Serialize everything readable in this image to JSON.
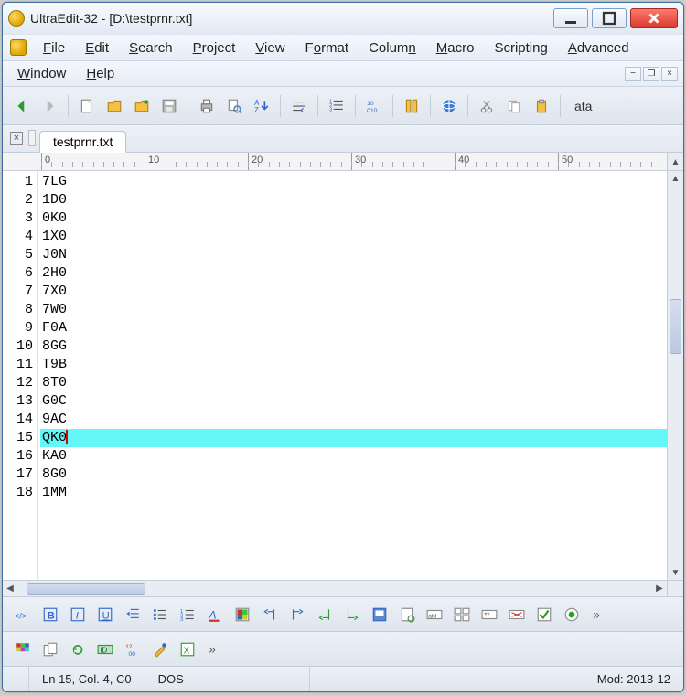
{
  "titlebar": {
    "title": "UltraEdit-32 - [D:\\testprnr.txt]"
  },
  "menubar": {
    "items": [
      "File",
      "Edit",
      "Search",
      "Project",
      "View",
      "Format",
      "Column",
      "Macro",
      "Scripting",
      "Advanced"
    ],
    "row2": [
      "Window",
      "Help"
    ]
  },
  "toolbar": {
    "textlabel": "ata"
  },
  "tab": {
    "label": "testprnr.txt"
  },
  "ruler": {
    "majors": [
      "0",
      "10",
      "20",
      "30",
      "40",
      "50"
    ],
    "right": "6"
  },
  "editor": {
    "highlight_line_index": 14,
    "lines": [
      {
        "n": 1,
        "t": "7LG"
      },
      {
        "n": 2,
        "t": "1D0"
      },
      {
        "n": 3,
        "t": "0K0"
      },
      {
        "n": 4,
        "t": "1X0"
      },
      {
        "n": 5,
        "t": "J0N"
      },
      {
        "n": 6,
        "t": "2H0"
      },
      {
        "n": 7,
        "t": "7X0"
      },
      {
        "n": 8,
        "t": "7W0"
      },
      {
        "n": 9,
        "t": "F0A"
      },
      {
        "n": 10,
        "t": "8GG"
      },
      {
        "n": 11,
        "t": "T9B"
      },
      {
        "n": 12,
        "t": "8T0"
      },
      {
        "n": 13,
        "t": "G0C"
      },
      {
        "n": 14,
        "t": "9AC"
      },
      {
        "n": 15,
        "t": "QK0"
      },
      {
        "n": 16,
        "t": "KA0"
      },
      {
        "n": 17,
        "t": "8G0"
      },
      {
        "n": 18,
        "t": "1MM"
      }
    ]
  },
  "status": {
    "pos": "Ln 15, Col. 4, C0",
    "encoding": "DOS",
    "modified": "Mod: 2013-12"
  }
}
